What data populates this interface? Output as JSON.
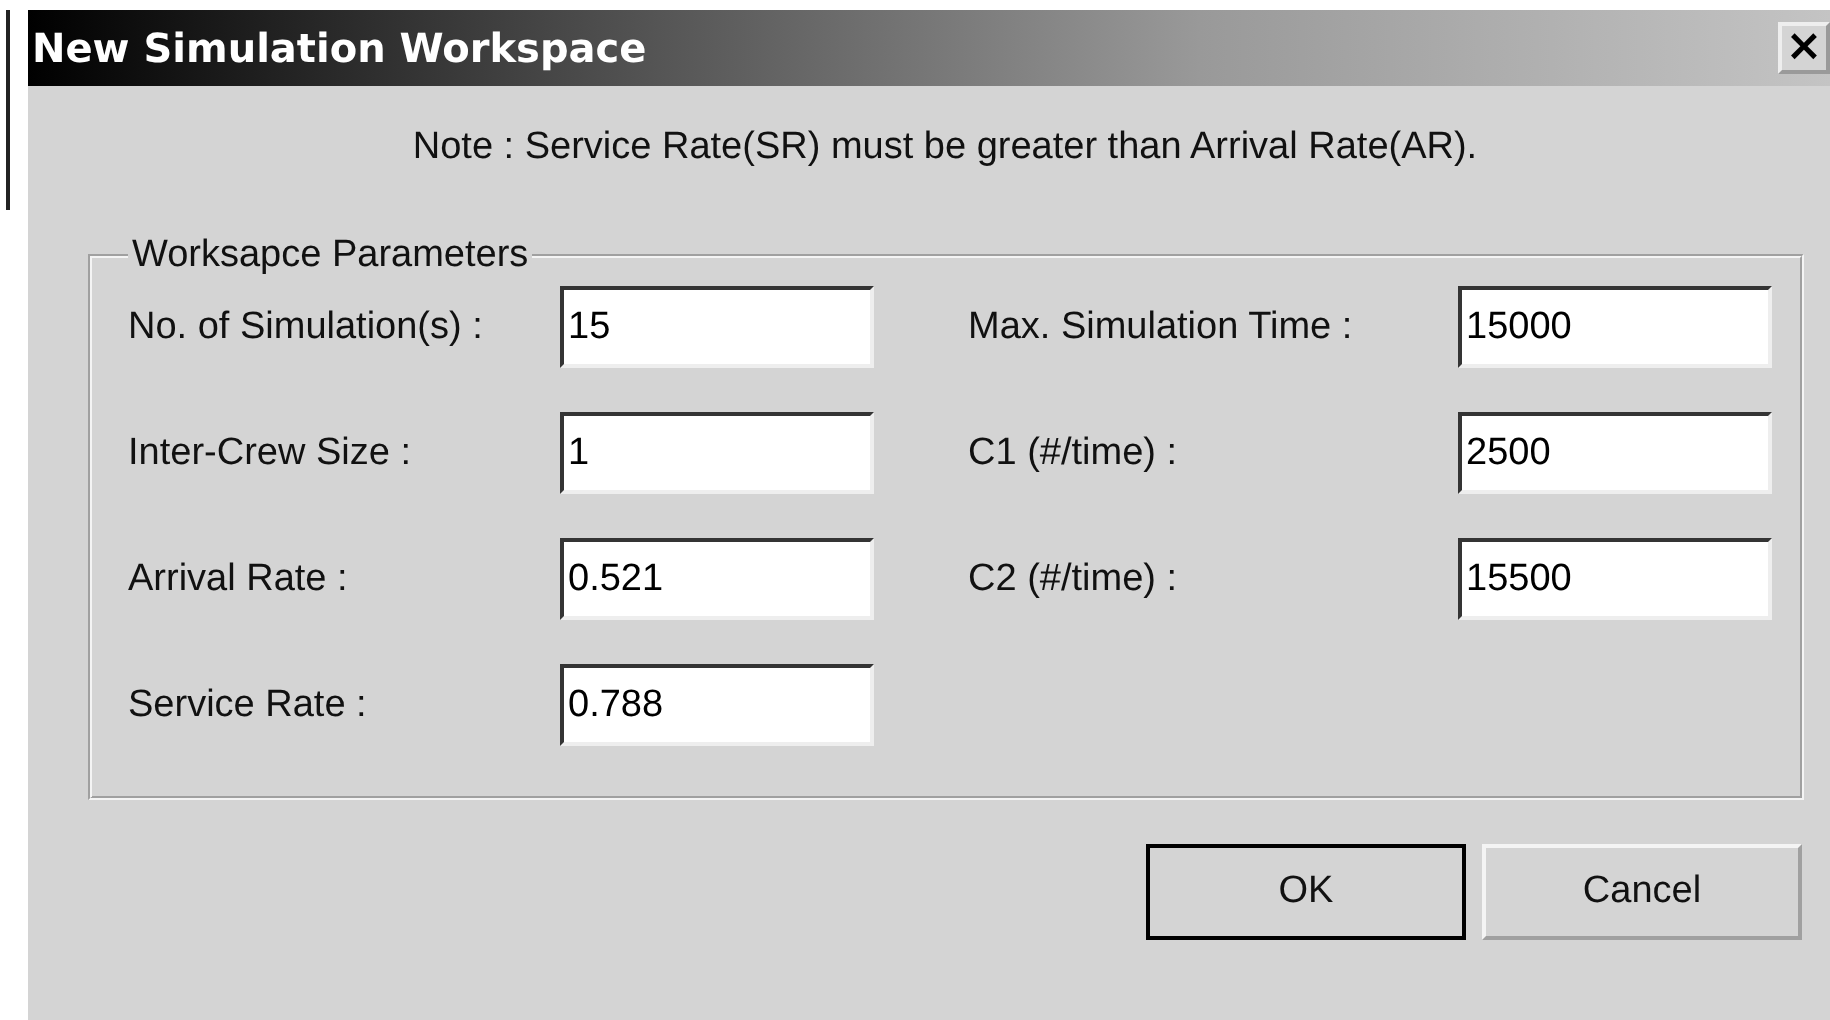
{
  "window": {
    "title": "New Simulation Workspace",
    "close": "×"
  },
  "note": "Note : Service Rate(SR) must be greater than Arrival Rate(AR).",
  "group": {
    "legend": "Worksapce Parameters",
    "left_fields": [
      {
        "label": "No. of Simulation(s) :",
        "value": "15"
      },
      {
        "label": "Inter-Crew Size :",
        "value": "1"
      },
      {
        "label": "Arrival Rate :",
        "value": "0.521"
      },
      {
        "label": "Service Rate :",
        "value": "0.788"
      }
    ],
    "right_fields": [
      {
        "label": "Max. Simulation Time :",
        "value": "15000"
      },
      {
        "label": "C1 (#/time) :",
        "value": "2500"
      },
      {
        "label": "C2 (#/time) :",
        "value": "15500"
      }
    ]
  },
  "buttons": [
    {
      "label": "OK",
      "default": true
    },
    {
      "label": "Cancel",
      "default": false
    }
  ]
}
